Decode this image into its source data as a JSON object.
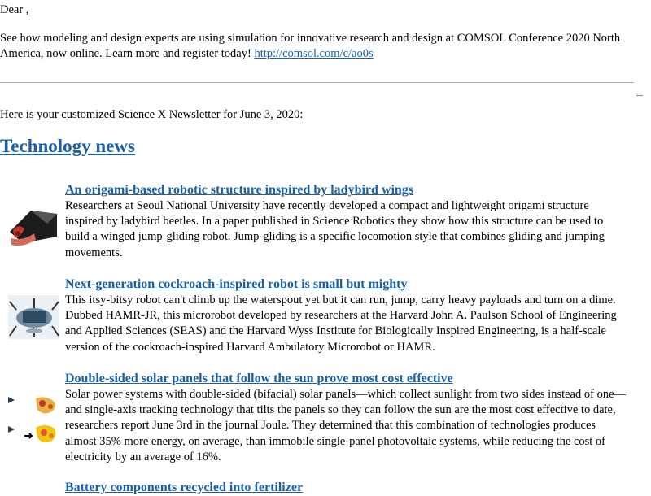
{
  "greeting": "Dear ,",
  "promo": {
    "text": "See how modeling and design experts are using simulation for innovative research and design at COMSOL Conference 2020 North America, now online. Learn more and register today! ",
    "link": "http://comsol.com/c/ao0s"
  },
  "intro": "Here is your customized Science X Newsletter for June 3, 2020:",
  "section": {
    "title": "Technology news"
  },
  "articles": [
    {
      "title": "An origami-based robotic structure inspired by ladybird wings",
      "summary": "Researchers at Seoul National University have recently developed a compact and lightweight origami structure inspired by ladybird beetles. In a paper published in Science Robotics they show how this structure can be used to build a winged jump-gliding robot. Jump-gliding is a specific locomotion style that combines gliding and jumping movements.",
      "thumb": "ladybird-robot-image"
    },
    {
      "title": "Next-generation cockroach-inspired robot is small but mighty",
      "summary": "This itsy-bitsy robot can't climb up the waterspout yet but it can run, jump, carry heavy payloads and turn on a dime. Dubbed HAMR-JR, this microrobot developed by researchers at the Harvard John A. Paulson School of Engineering and Applied Sciences (SEAS) and the Harvard Wyss Institute for Biologically Inspired Engineering, is a half-scale version of the cockroach-inspired Harvard Ambulatory Microrobot or HAMR.",
      "thumb": "cockroach-robot-image"
    },
    {
      "title": "Double-sided solar panels that follow the sun prove most cost effective",
      "summary": "Solar power systems with double-sided (bifacial) solar panels—which collect sunlight from two sides instead of one—and single-axis tracking technology that tilts the panels so they can follow the sun are the most cost effective to date, researchers report June 3rd in the journal Joule. They determined that this combination of technologies produces almost 35% more energy, on average, than immobile single-panel photovoltaic systems, while reducing the cost of electricity by an average of 16%.",
      "thumb": "solar-map-image"
    },
    {
      "title": "Battery components recycled into fertilizer"
    }
  ]
}
